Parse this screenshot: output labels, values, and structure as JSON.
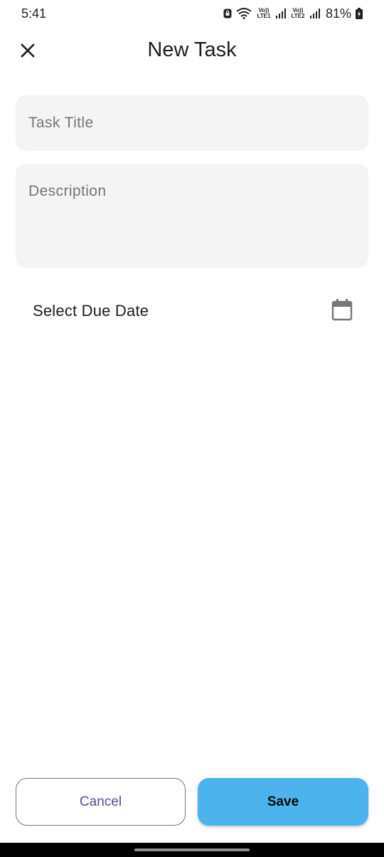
{
  "status_bar": {
    "time": "5:41",
    "sim1_tag": "Vo)) LTE1",
    "sim2_tag": "Vo)) LTE2",
    "battery_percent": "81%",
    "icons": [
      "lock-icon",
      "wifi-icon",
      "signal-icon",
      "battery-icon"
    ]
  },
  "app_bar": {
    "title": "New Task",
    "close_icon": "close-icon"
  },
  "form": {
    "title_placeholder": "Task Title",
    "description_placeholder": "Description",
    "due_date_label": "Select Due Date",
    "due_date_icon": "calendar-icon"
  },
  "actions": {
    "cancel_label": "Cancel",
    "save_label": "Save"
  },
  "colors": {
    "save_bg": "#4db3ec",
    "cancel_text": "#5b4a93",
    "field_bg": "#f4f4f5"
  }
}
